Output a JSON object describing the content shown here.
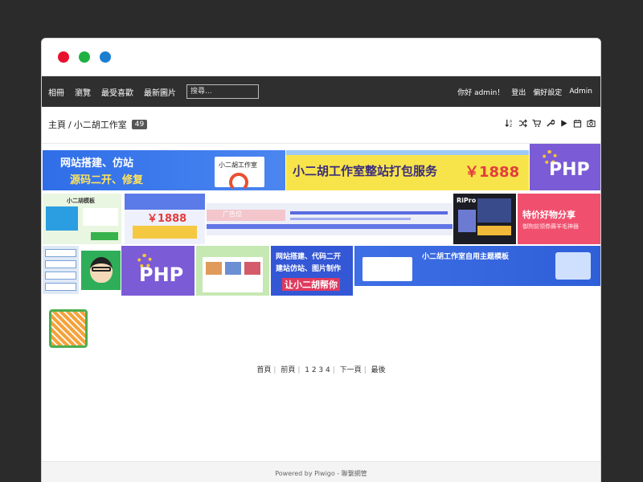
{
  "window": {
    "dots": [
      "red",
      "green",
      "blue"
    ]
  },
  "nav": {
    "links": [
      "相冊",
      "瀏覽",
      "最受喜歡",
      "最新圖片"
    ],
    "search_placeholder": "搜尋...",
    "greeting": "你好 admin！",
    "logout": "登出",
    "preferences": "偏好設定",
    "admin": "Admin"
  },
  "breadcrumb": {
    "home": "主頁",
    "separator": "/",
    "album": "小二胡工作室",
    "count": "49"
  },
  "toolbar": {
    "icons": [
      "sort-order-icon",
      "random-icon",
      "cart-icon",
      "wrench-icon",
      "play-icon",
      "calendar-icon",
      "camera-icon"
    ]
  },
  "thumbnails": {
    "t1": {
      "line1": "网站搭建、仿站",
      "line2": "源码二开、修复",
      "card": "小二胡工作室"
    },
    "t2": {
      "text": "小二胡工作室整站打包服务",
      "price": "￥1888"
    },
    "t3": {
      "text": "PHP"
    },
    "t4": {
      "title": "小二胡模板"
    },
    "t5": {
      "price": "￥1888"
    },
    "t6": {
      "text": "广告位"
    },
    "t7": {
      "title": "RiPro"
    },
    "t8": {
      "line1": "特价好物分享",
      "line2": "御狗前领券薅羊毛神器"
    },
    "t10": {
      "text": "PHP"
    },
    "t12": {
      "line1": "网站搭建、代码二开",
      "line2": "建站仿站、图片制作",
      "line3": "让小二胡帮你"
    },
    "t13": {
      "title": "小二胡工作室自用主题模板"
    }
  },
  "pager": {
    "first": "首頁",
    "prev": "前頁",
    "pages": "1 2 3 4",
    "next": "下一頁",
    "last": "最後"
  },
  "footer": {
    "text": "Powered by Piwigo - 聯繫網管"
  },
  "colors": {
    "navbar": "#2f2f2f",
    "php_purple": "#7b5bd6",
    "red_promo": "#f0506e",
    "blue_banner": "#3457d5"
  }
}
